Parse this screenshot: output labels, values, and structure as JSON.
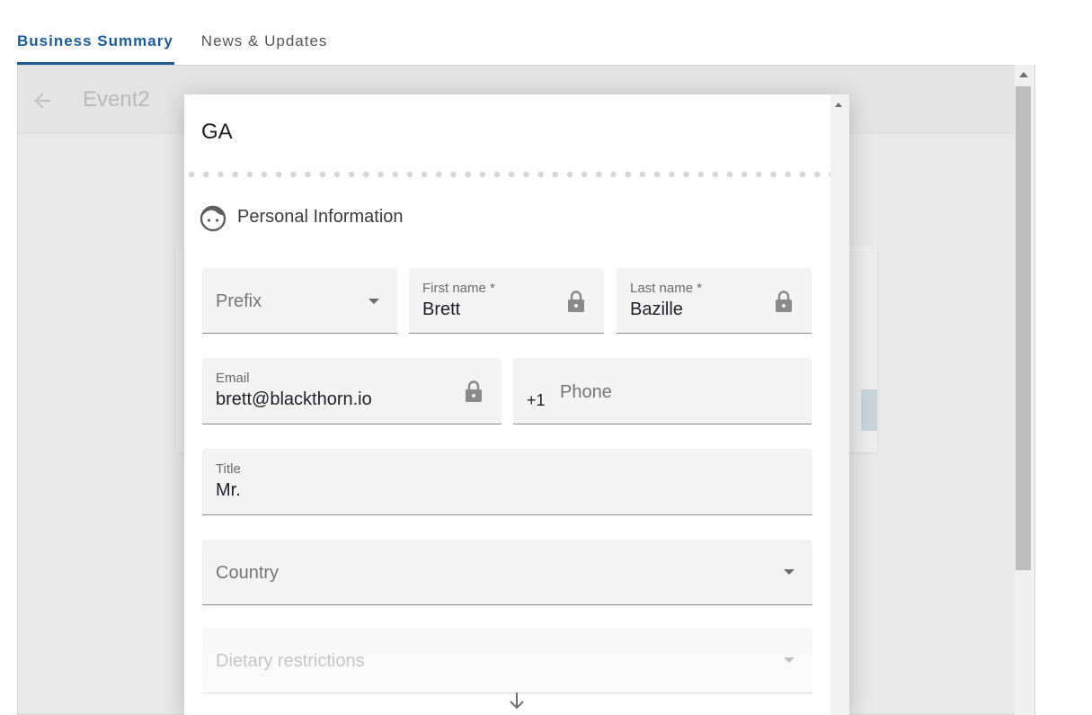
{
  "tabs": [
    {
      "label": "Business Summary",
      "active": true
    },
    {
      "label": "News & Updates",
      "active": false
    }
  ],
  "background": {
    "event_title": "Event2",
    "back_icon": "arrow-left-icon"
  },
  "dialog": {
    "title": "GA",
    "section": {
      "title": "Personal Information",
      "icon": "face-icon"
    },
    "fields": {
      "prefix": {
        "placeholder": "Prefix"
      },
      "first_name": {
        "label": "First name *",
        "value": "Brett",
        "locked": true
      },
      "last_name": {
        "label": "Last name *",
        "value": "Bazille",
        "locked": true
      },
      "email": {
        "label": "Email",
        "value": "brett@blackthorn.io",
        "locked": true
      },
      "phone": {
        "country_code": "+1",
        "placeholder": "Phone"
      },
      "title": {
        "label": "Title",
        "value": "Mr."
      },
      "country": {
        "placeholder": "Country"
      },
      "dietary": {
        "placeholder": "Dietary restrictions"
      }
    },
    "scroll_hint_icon": "arrow-down-icon"
  },
  "colors": {
    "accent": "#1c5d99",
    "field_bg": "#f3f3f3",
    "overlay_bg": "#e9e9e9"
  }
}
